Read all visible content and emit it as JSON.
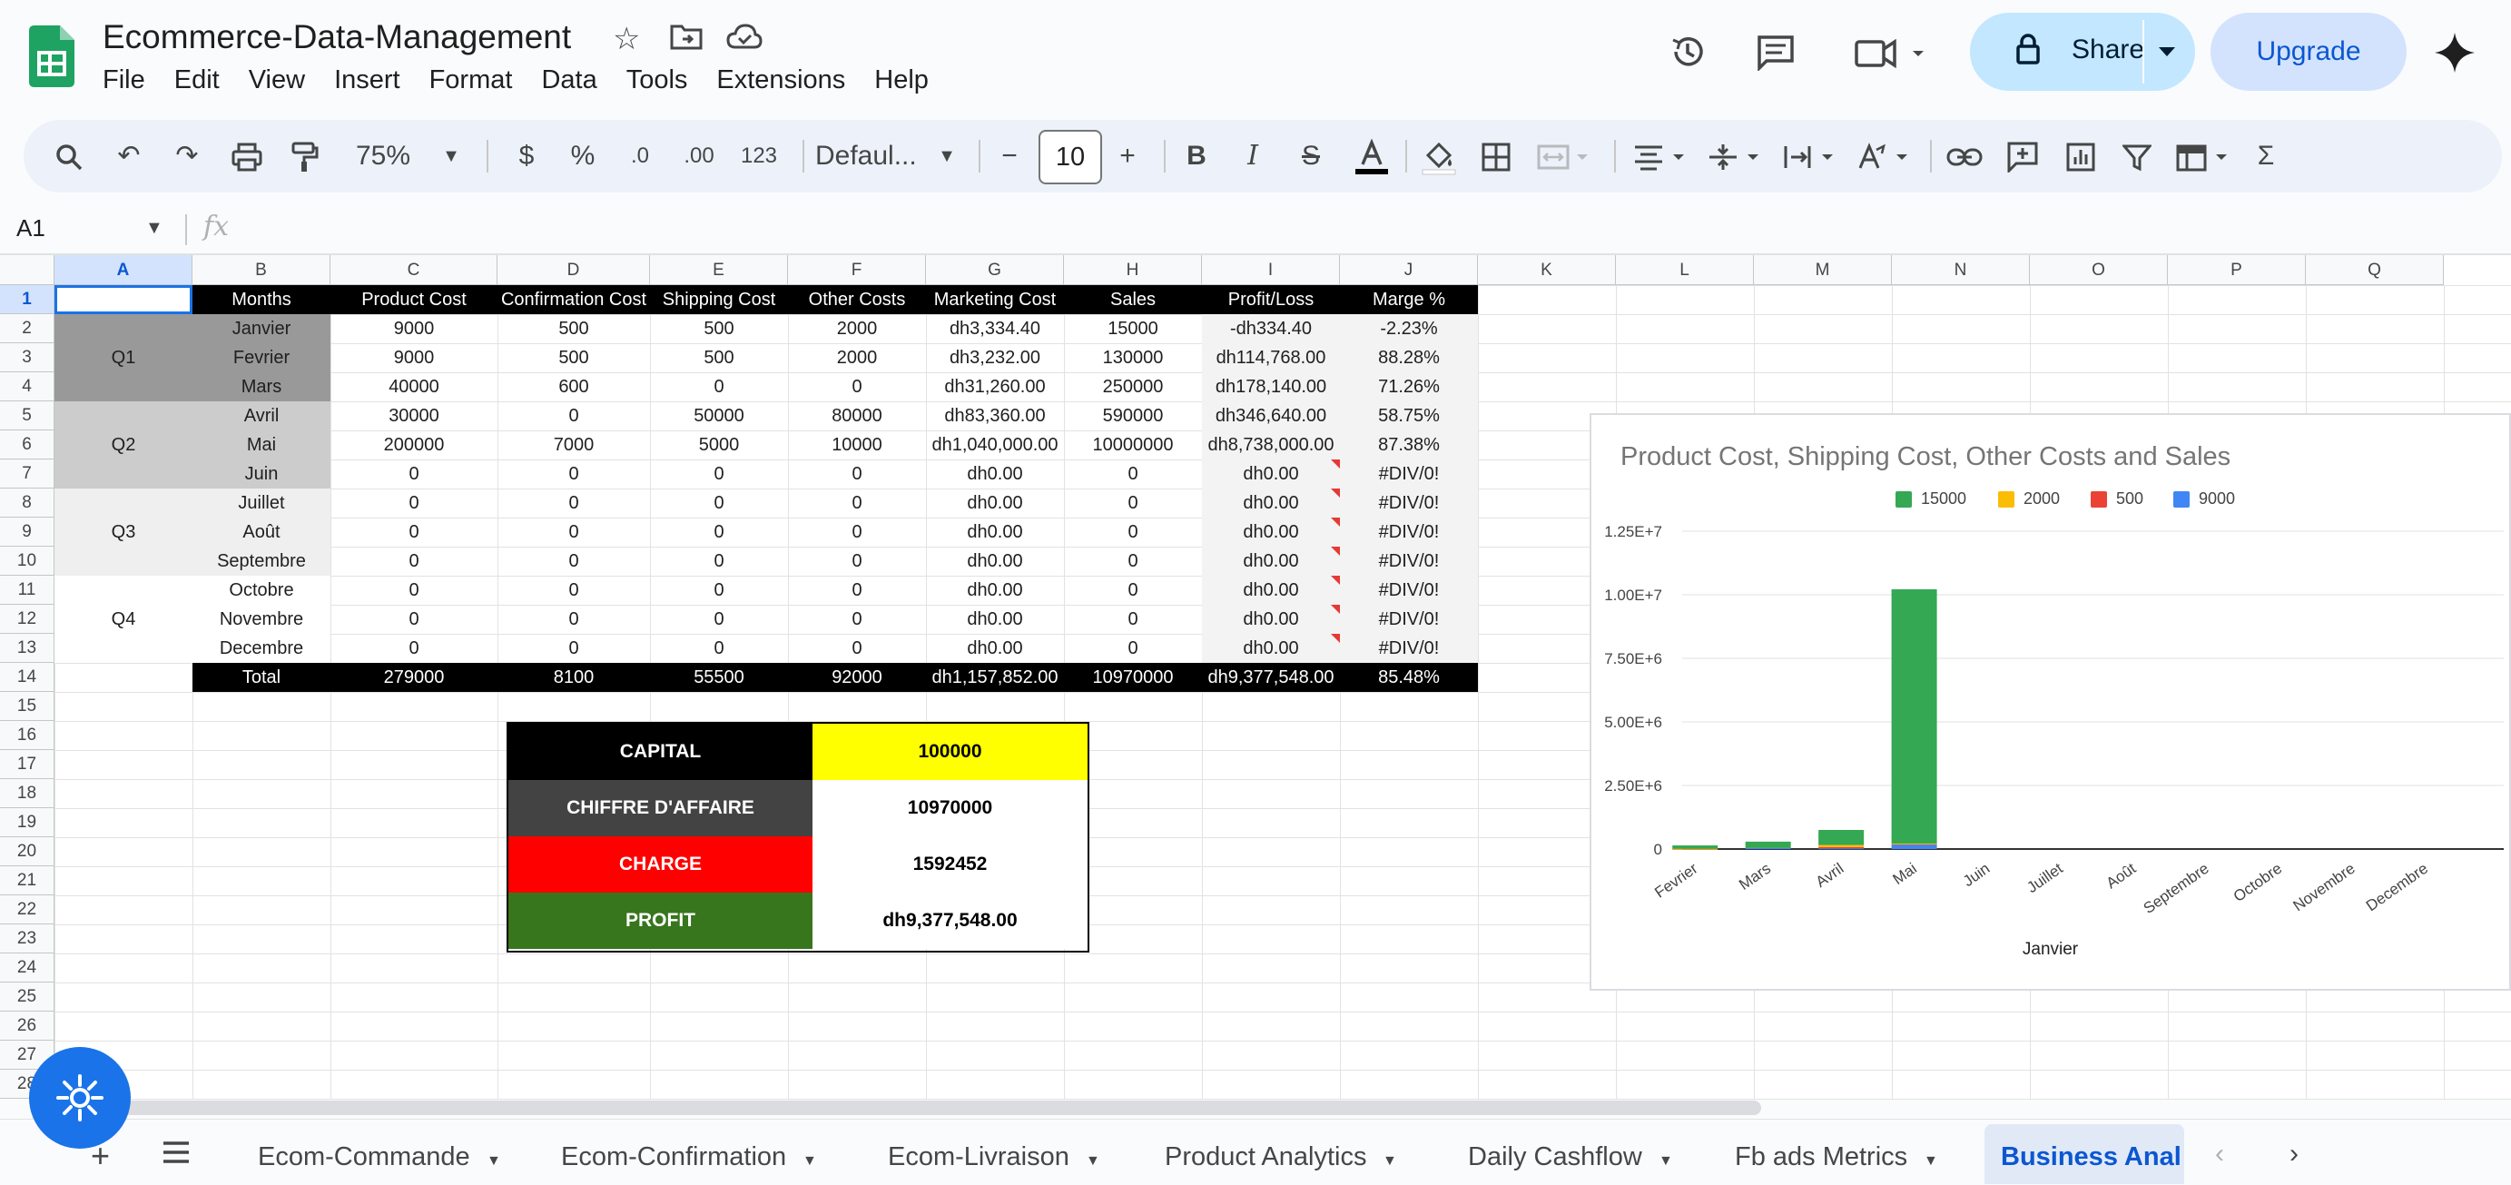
{
  "app": {
    "title": "Ecommerce-Data-Management",
    "menu": [
      "File",
      "Edit",
      "View",
      "Insert",
      "Format",
      "Data",
      "Tools",
      "Extensions",
      "Help"
    ],
    "share_label": "Share",
    "upgrade_label": "Upgrade"
  },
  "toolbar": {
    "zoom": "75%",
    "currency": "$",
    "percent": "%",
    "dec_decrease": ".0",
    "dec_increase": ".00",
    "number_format": "123",
    "font": "Defaul...",
    "font_size": "10",
    "bold": "B",
    "italic": "I"
  },
  "formula_bar": {
    "cell_ref": "A1",
    "fx": "fx"
  },
  "columns": [
    "A",
    "B",
    "C",
    "D",
    "E",
    "F",
    "G",
    "H",
    "I",
    "J",
    "K",
    "L",
    "M",
    "N",
    "O",
    "P",
    "Q"
  ],
  "rows": [
    "1",
    "2",
    "3",
    "4",
    "5",
    "6",
    "7",
    "8",
    "9",
    "10",
    "11",
    "12",
    "13",
    "14",
    "15",
    "16",
    "17",
    "18",
    "19",
    "20",
    "21",
    "22",
    "23",
    "24",
    "25",
    "26",
    "27",
    "28"
  ],
  "table": {
    "headers": [
      "Months",
      "Product Cost",
      "Confirmation Cost",
      "Shipping Cost",
      "Other Costs",
      "Marketing Cost",
      "Sales",
      "Profit/Loss",
      "Marge %"
    ],
    "quarters": [
      "Q1",
      "Q2",
      "Q3",
      "Q4"
    ],
    "rows": [
      [
        "Janvier",
        "9000",
        "500",
        "500",
        "2000",
        "dh3,334.40",
        "15000",
        "-dh334.40",
        "-2.23%"
      ],
      [
        "Fevrier",
        "9000",
        "500",
        "500",
        "2000",
        "dh3,232.00",
        "130000",
        "dh114,768.00",
        "88.28%"
      ],
      [
        "Mars",
        "40000",
        "600",
        "0",
        "0",
        "dh31,260.00",
        "250000",
        "dh178,140.00",
        "71.26%"
      ],
      [
        "Avril",
        "30000",
        "0",
        "50000",
        "80000",
        "dh83,360.00",
        "590000",
        "dh346,640.00",
        "58.75%"
      ],
      [
        "Mai",
        "200000",
        "7000",
        "5000",
        "10000",
        "dh1,040,000.00",
        "10000000",
        "dh8,738,000.00",
        "87.38%"
      ],
      [
        "Juin",
        "0",
        "0",
        "0",
        "0",
        "dh0.00",
        "0",
        "dh0.00",
        "#DIV/0!"
      ],
      [
        "Juillet",
        "0",
        "0",
        "0",
        "0",
        "dh0.00",
        "0",
        "dh0.00",
        "#DIV/0!"
      ],
      [
        "Août",
        "0",
        "0",
        "0",
        "0",
        "dh0.00",
        "0",
        "dh0.00",
        "#DIV/0!"
      ],
      [
        "Septembre",
        "0",
        "0",
        "0",
        "0",
        "dh0.00",
        "0",
        "dh0.00",
        "#DIV/0!"
      ],
      [
        "Octobre",
        "0",
        "0",
        "0",
        "0",
        "dh0.00",
        "0",
        "dh0.00",
        "#DIV/0!"
      ],
      [
        "Novembre",
        "0",
        "0",
        "0",
        "0",
        "dh0.00",
        "0",
        "dh0.00",
        "#DIV/0!"
      ],
      [
        "Decembre",
        "0",
        "0",
        "0",
        "0",
        "dh0.00",
        "0",
        "dh0.00",
        "#DIV/0!"
      ]
    ],
    "total": [
      "Total",
      "279000",
      "8100",
      "55500",
      "92000",
      "dh1,157,852.00",
      "10970000",
      "dh9,377,548.00",
      "85.48%"
    ]
  },
  "summary": [
    {
      "label": "CAPITAL",
      "value": "100000",
      "color": "#000000",
      "value_bg": "#ffff00"
    },
    {
      "label": "CHIFFRE D'AFFAIRE",
      "value": "10970000",
      "color": "#434343",
      "value_bg": "#ffffff"
    },
    {
      "label": "CHARGE",
      "value": "1592452",
      "color": "#ff0000",
      "value_bg": "#ffffff"
    },
    {
      "label": "PROFIT",
      "value": "dh9,377,548.00",
      "color": "#38761d",
      "value_bg": "#ffffff"
    }
  ],
  "chart_data": {
    "type": "bar",
    "stacked": true,
    "title": "Product Cost, Shipping Cost, Other Costs and Sales",
    "xlabel": "Janvier",
    "ylabel": "",
    "categories": [
      "Fevrier",
      "Mars",
      "Avril",
      "Mai",
      "Juin",
      "Juillet",
      "Août",
      "Septembre",
      "Octobre",
      "Novembre",
      "Decembre"
    ],
    "series": [
      {
        "name": "9000",
        "color": "#4285f4",
        "values": [
          9000,
          40000,
          30000,
          200000,
          0,
          0,
          0,
          0,
          0,
          0,
          0
        ]
      },
      {
        "name": "500",
        "color": "#ea4335",
        "values": [
          500,
          0,
          50000,
          5000,
          0,
          0,
          0,
          0,
          0,
          0,
          0
        ]
      },
      {
        "name": "2000",
        "color": "#fbbc04",
        "values": [
          2000,
          0,
          80000,
          10000,
          0,
          0,
          0,
          0,
          0,
          0,
          0
        ]
      },
      {
        "name": "15000",
        "color": "#34a853",
        "values": [
          130000,
          250000,
          590000,
          10000000,
          0,
          0,
          0,
          0,
          0,
          0,
          0
        ]
      }
    ],
    "legend_order": [
      "15000",
      "2000",
      "500",
      "9000"
    ],
    "yticks": [
      "0",
      "2.50E+6",
      "5.00E+6",
      "7.50E+6",
      "1.00E+7",
      "1.25E+7"
    ],
    "ytick_values": [
      0,
      2500000,
      5000000,
      7500000,
      10000000,
      12500000
    ],
    "ylim": [
      0,
      12500000
    ],
    "legend_position": "top",
    "grid": true
  },
  "sheets": [
    "Ecom-Commande",
    "Ecom-Confirmation",
    "Ecom-Livraison",
    "Product Analytics",
    "Daily Cashflow",
    "Fb ads Metrics",
    "Business Anal"
  ],
  "active_sheet": "Business Anal",
  "colors": {
    "accent": "#0b57d0",
    "share_bg": "#c2e7ff",
    "selected_header": "#d3e3fd"
  }
}
